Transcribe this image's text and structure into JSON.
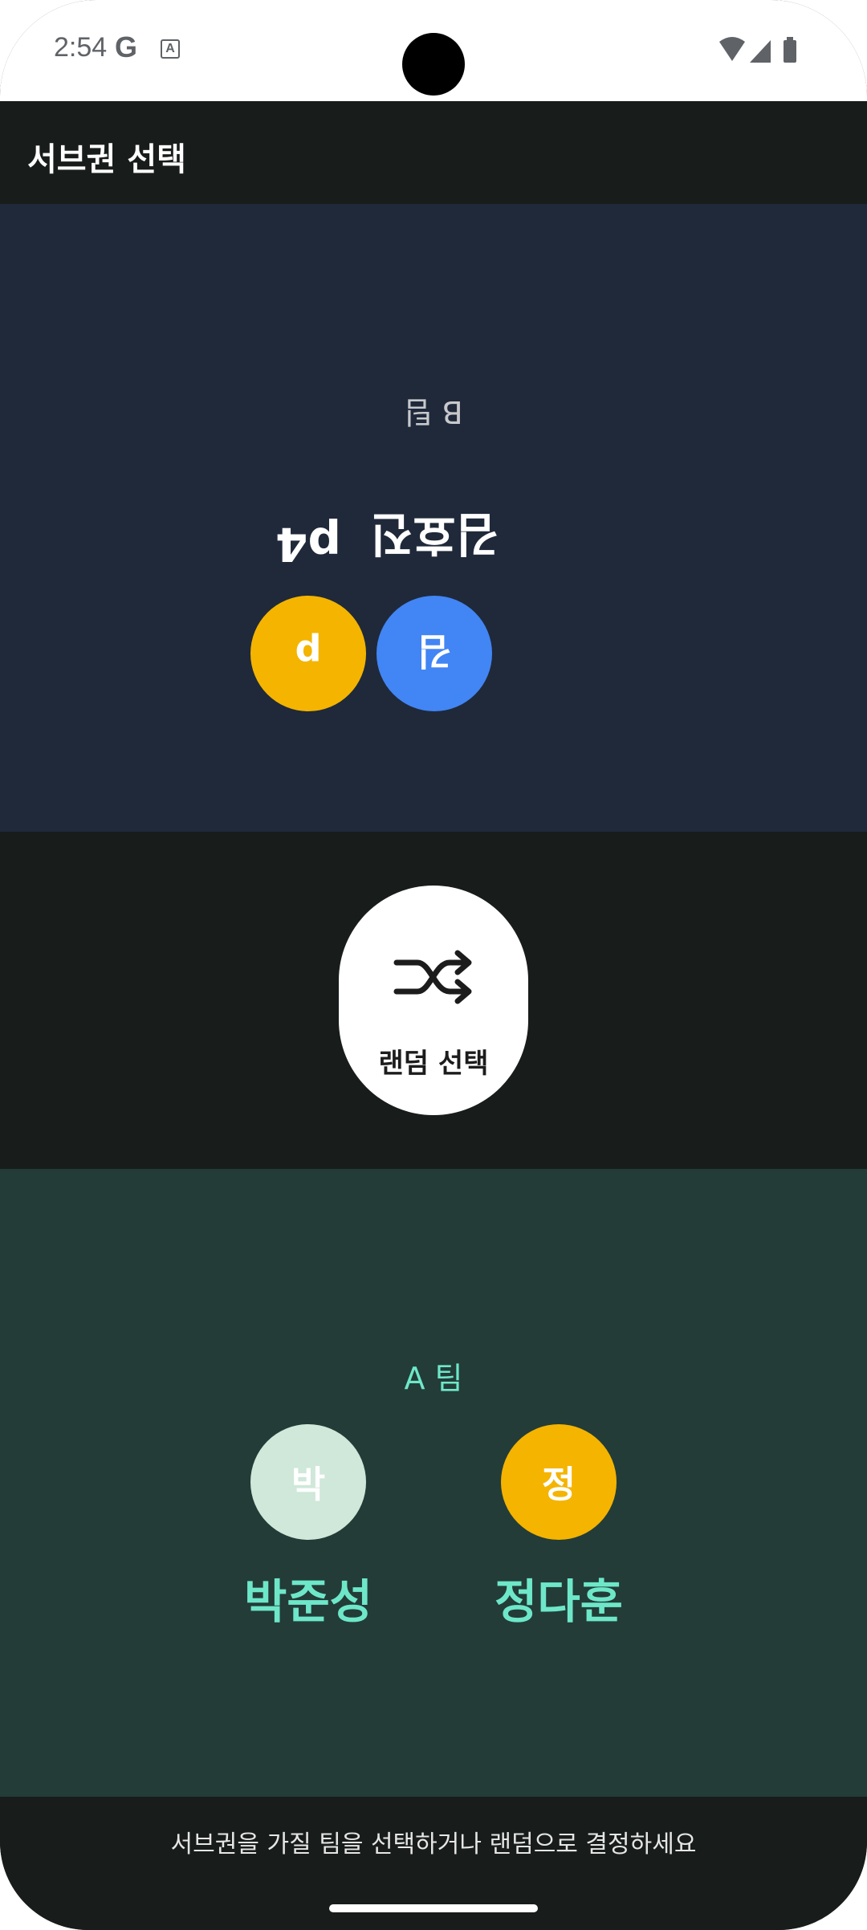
{
  "status_bar": {
    "time": "2:54",
    "google_icon": "G",
    "accessibility_icon": "A"
  },
  "app_bar": {
    "title": "서브권 선택"
  },
  "team_b": {
    "label": "B 팀",
    "background": "#1f293a",
    "players": [
      {
        "initial": "김",
        "name": "김효진",
        "color": "#4285f4"
      },
      {
        "initial": "p",
        "name": "p4",
        "color": "#f4b400"
      }
    ]
  },
  "random_button": {
    "label": "랜덤 선택",
    "icon": "shuffle-icon"
  },
  "team_a": {
    "label": "A 팀",
    "background": "#233c38",
    "accent": "#6ee7c9",
    "players": [
      {
        "initial": "박",
        "name": "박준성",
        "color": "#cfe8d9"
      },
      {
        "initial": "정",
        "name": "정다훈",
        "color": "#f4b400"
      }
    ]
  },
  "footer": {
    "hint": "서브권을 가질 팀을 선택하거나 랜덤으로 결정하세요"
  }
}
